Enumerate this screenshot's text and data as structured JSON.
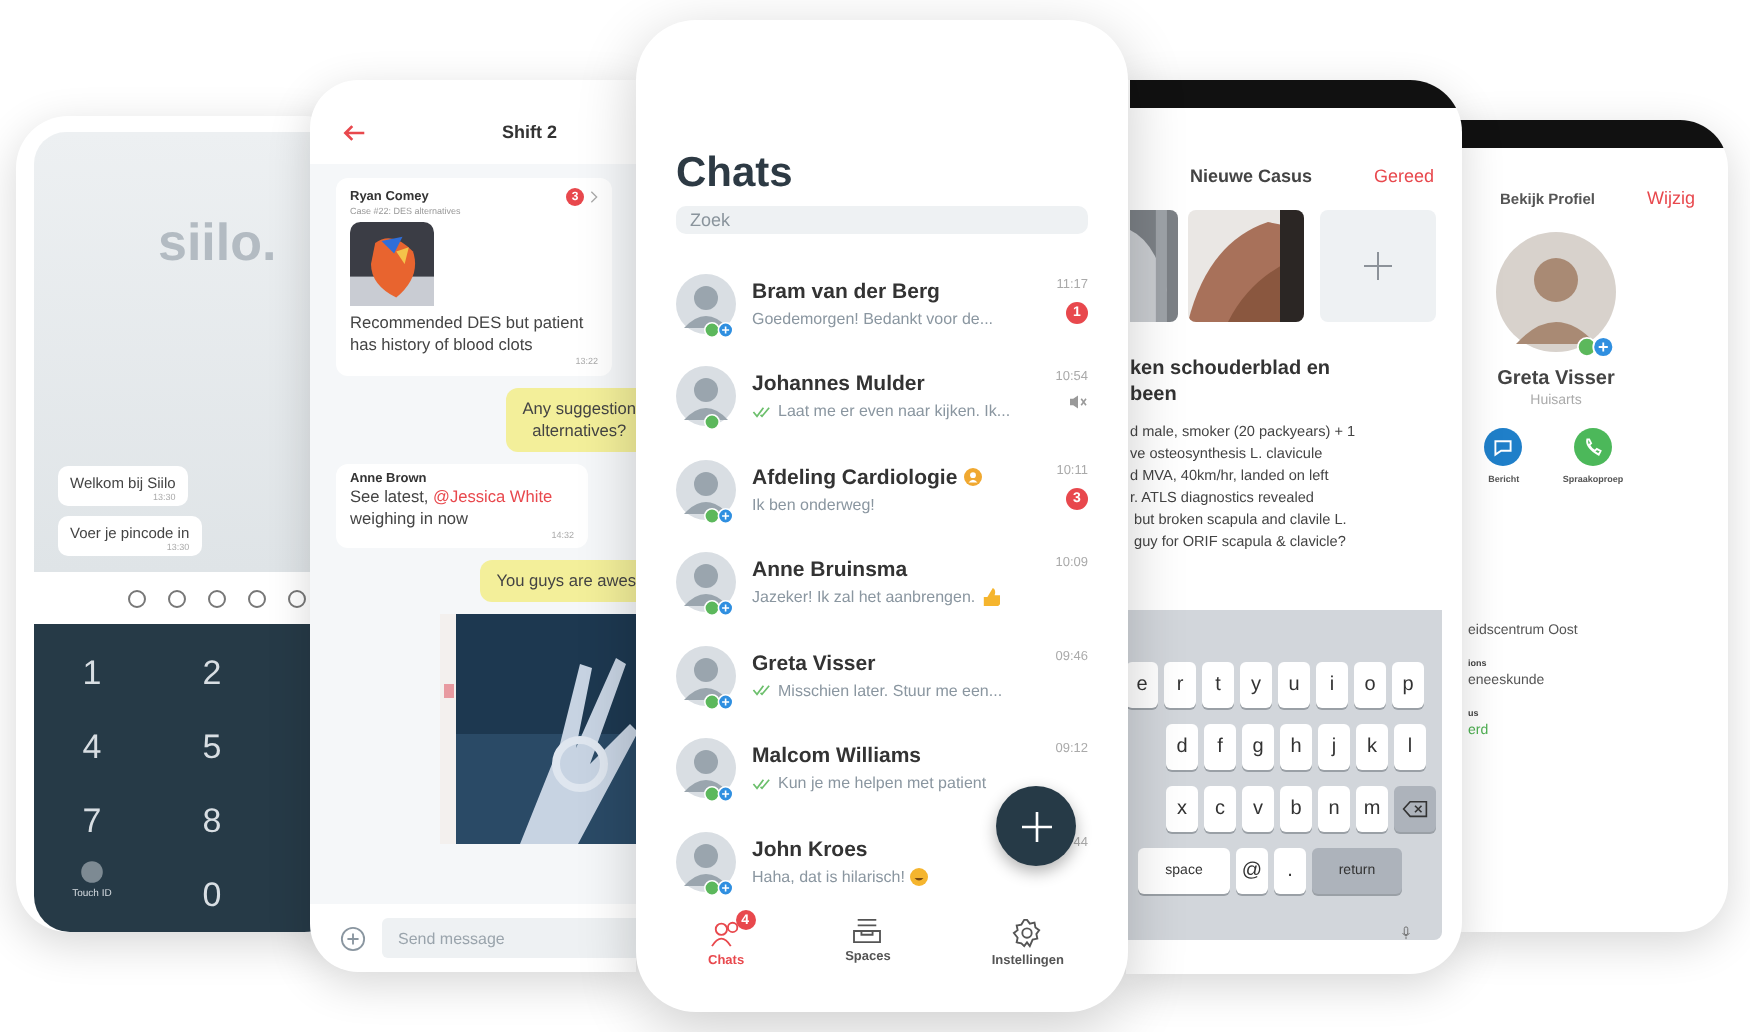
{
  "lock_screen": {
    "logo": "siilo.",
    "messages": [
      {
        "text": "Welkom bij Siilo",
        "time": "13:30"
      },
      {
        "text": "Voer je pincode in",
        "time": "13:30"
      }
    ],
    "pin_dots": [
      {
        "filled": false
      },
      {
        "filled": false
      },
      {
        "filled": false
      },
      {
        "filled": false
      },
      {
        "filled": false
      }
    ],
    "keys": [
      {
        "kind": "digit",
        "label": "1"
      },
      {
        "kind": "digit",
        "label": "2"
      },
      {
        "kind": "digit",
        "label": "4"
      },
      {
        "kind": "digit",
        "label": "5"
      },
      {
        "kind": "digit",
        "label": "7"
      },
      {
        "kind": "digit",
        "label": "8"
      },
      {
        "kind": "touch_id",
        "label": "Touch ID"
      },
      {
        "kind": "digit",
        "label": "0"
      }
    ]
  },
  "shift_chat": {
    "title": "Shift 2",
    "messages": [
      {
        "kind": "case",
        "sender": "Ryan Comey",
        "subtitle": "Case #22: DES alternatives",
        "badge": "3",
        "text": "Recommended DES but patient has history of blood clots",
        "time": "13:22"
      },
      {
        "kind": "outgoing",
        "text": "Any suggestion\nalternatives?"
      },
      {
        "kind": "incoming",
        "sender": "Anne Brown",
        "before": "See latest, ",
        "mention": "@Jessica White",
        "after": " weighing in now",
        "time": "14:32"
      },
      {
        "kind": "outgoing",
        "text": "You guys are awes"
      },
      {
        "kind": "picture"
      }
    ],
    "composer": {
      "placeholder": "Send message"
    }
  },
  "chats_screen": {
    "title": "Chats",
    "search": {
      "placeholder": "Zoek"
    },
    "chats": [
      {
        "name": "Bram van der Berg",
        "preview": "Goedemorgen! Bedankt voor de...",
        "time": "11:17",
        "unread": "1",
        "read": false,
        "muted": false,
        "group": false,
        "plus_badge": true
      },
      {
        "name": "Johannes Mulder",
        "preview": "Laat me er even naar kijken. Ik...",
        "time": "10:54",
        "read": true,
        "muted": true,
        "group": false,
        "plus_badge": false
      },
      {
        "name": "Afdeling Cardiologie",
        "preview": "Ik ben onderweg!",
        "time": "10:11",
        "unread": "3",
        "read": false,
        "muted": false,
        "group": true,
        "plus_badge": true
      },
      {
        "name": "Anne Bruinsma",
        "preview": "Jazeker! Ik zal het aanbrengen.",
        "kind": "thumbsup",
        "time": "10:09",
        "read": false,
        "muted": false,
        "group": false,
        "plus_badge": true
      },
      {
        "name": "Greta Visser",
        "preview": "Misschien later. Stuur me een...",
        "time": "09:46",
        "read": true,
        "muted": false,
        "group": false,
        "plus_badge": true
      },
      {
        "name": "Malcom Williams",
        "preview": "Kun je me helpen met patient",
        "time": "09:12",
        "read": true,
        "muted": false,
        "group": false,
        "plus_badge": true
      },
      {
        "name": "John Kroes",
        "preview": "Haha, dat is hilarisch!",
        "kind": "laugh",
        "time": "44",
        "read": false,
        "muted": false,
        "group": false,
        "plus_badge": true
      }
    ],
    "tabs": [
      {
        "kind": "people",
        "label": "Chats",
        "selected": true,
        "badge": "4"
      },
      {
        "kind": "tray",
        "label": "Spaces",
        "selected": false
      },
      {
        "kind": "gear",
        "label": "Instellingen",
        "selected": false
      }
    ]
  },
  "case_screen": {
    "title": "Nieuwe Casus",
    "action": "Gereed",
    "heading": "ken schouderblad en\nbeen",
    "body": "d male, smoker (20 packyears) + 1\nve osteosynthesis L. clavicule\nd MVA, 40km/hr, landed on left\nr. ATLS diagnostics revealed\n but broken scapula and clavile L.\n guy for ORIF scapula & clavicle?",
    "keyboard_rows": [
      [
        {
          "kind": "char",
          "label": "e"
        },
        {
          "kind": "char",
          "label": "r"
        },
        {
          "kind": "char",
          "label": "t"
        },
        {
          "kind": "char",
          "label": "y"
        },
        {
          "kind": "char",
          "label": "u"
        },
        {
          "kind": "char",
          "label": "i"
        },
        {
          "kind": "char",
          "label": "o"
        },
        {
          "kind": "char",
          "label": "p"
        }
      ],
      [
        {
          "kind": "char",
          "label": "d"
        },
        {
          "kind": "char",
          "label": "f"
        },
        {
          "kind": "char",
          "label": "g"
        },
        {
          "kind": "char",
          "label": "h"
        },
        {
          "kind": "char",
          "label": "j"
        },
        {
          "kind": "char",
          "label": "k"
        },
        {
          "kind": "char",
          "label": "l"
        }
      ],
      [
        {
          "kind": "char",
          "label": "x"
        },
        {
          "kind": "char",
          "label": "c"
        },
        {
          "kind": "char",
          "label": "v"
        },
        {
          "kind": "char",
          "label": "b"
        },
        {
          "kind": "char",
          "label": "n"
        },
        {
          "kind": "char",
          "label": "m"
        },
        {
          "kind": "backspace"
        }
      ],
      [
        {
          "kind": "wide",
          "label": "space"
        },
        {
          "kind": "char",
          "label": "@"
        },
        {
          "kind": "char",
          "label": "."
        },
        {
          "kind": "action",
          "label": "return"
        }
      ]
    ]
  },
  "profile_screen": {
    "title": "Bekijk Profiel",
    "action": "Wijzig",
    "name": "Greta Visser",
    "role": "Huisarts",
    "actions": [
      {
        "kind": "message",
        "label": "Bericht"
      },
      {
        "kind": "call",
        "label": "Spraakoproep"
      }
    ],
    "details": [
      {
        "value": "eidscentrum Oost"
      },
      {
        "label": "ions",
        "value": "eneeskunde"
      },
      {
        "label": "us",
        "value": "erd",
        "kind": "status"
      }
    ]
  }
}
